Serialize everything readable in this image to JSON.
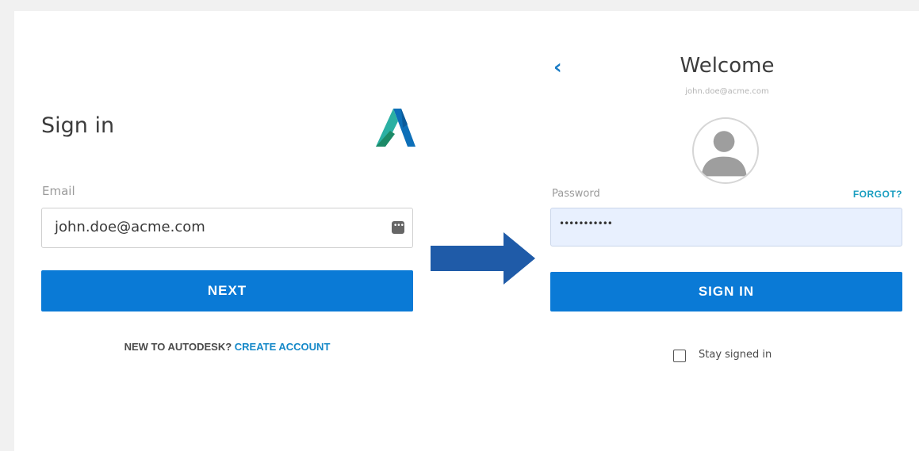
{
  "signin_panel": {
    "title": "Sign in",
    "logo_icon": "autodesk-logo-icon",
    "email_label": "Email",
    "email_value": "john.doe@acme.com",
    "password_manager_icon": "password-manager-icon",
    "next_label": "NEXT",
    "new_prefix": "NEW TO AUTODESK?",
    "create_account_label": "CREATE ACCOUNT"
  },
  "transition_arrow_icon": "arrow-right-icon",
  "password_panel": {
    "back_icon": "chevron-left-icon",
    "back_glyph": "‹",
    "title": "Welcome",
    "email": "john.doe@acme.com",
    "avatar_icon": "user-avatar-icon",
    "password_label": "Password",
    "forgot_label": "FORGOT?",
    "password_value": "•••••••••••",
    "signin_label": "SIGN IN",
    "stay_signed_in_label": "Stay signed in",
    "stay_signed_in_checked": false
  },
  "colors": {
    "primary_button": "#0a7ad6",
    "link": "#1488c8",
    "arrow": "#1f5ba8",
    "autofill_bg": "#e8f0fe"
  }
}
